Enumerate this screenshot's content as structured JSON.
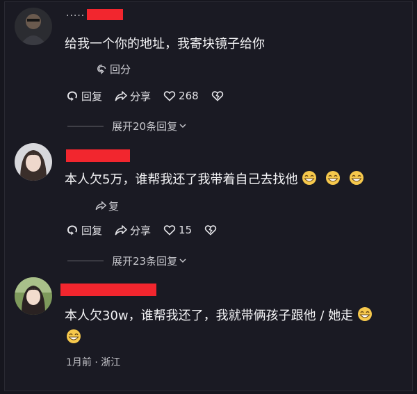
{
  "comments": [
    {
      "name_partial": "·····",
      "text": "给我一个你的地址，我寄块镜子给你",
      "reply_preview": "回分",
      "actions": {
        "reply": "回复",
        "share": "分享",
        "likes": "268"
      },
      "expand": "展开20条回复"
    },
    {
      "text": "本人欠5万，谁帮我还了我带着自己去找他",
      "reply_preview": "复",
      "actions": {
        "reply": "回复",
        "share": "分享",
        "likes": "15"
      },
      "expand": "展开23条回复"
    },
    {
      "text": "本人欠30w，谁帮我还了，我就带俩孩子跟他 / 她走",
      "meta": "1月前 · 浙江"
    }
  ],
  "colors": {
    "background": "#1a1a23",
    "text": "#f4f4f6",
    "redaction": "#f2262e",
    "muted": "#c7c7cc"
  },
  "icons": [
    "avatar",
    "reply-icon",
    "share-icon",
    "like-heart-icon",
    "dislike-broken-heart-icon",
    "chevron-down-icon",
    "grin-emoji-icon"
  ]
}
